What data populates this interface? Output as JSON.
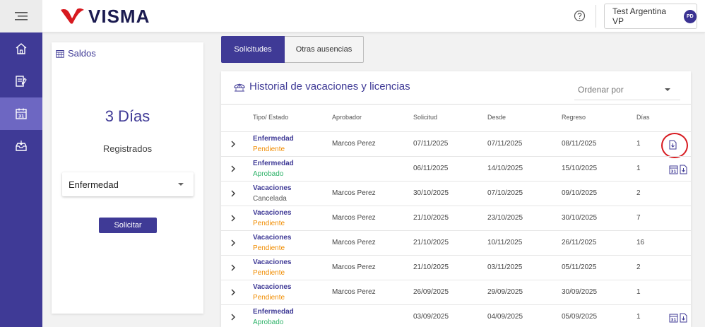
{
  "header": {
    "brand": "VISMA",
    "user_name": "Test Argentina VP",
    "user_initials": "PD"
  },
  "sidebar": {
    "items": [
      {
        "icon": "home-icon"
      },
      {
        "icon": "document-edit-icon"
      },
      {
        "icon": "calendar-icon",
        "active": true
      },
      {
        "icon": "inbox-icon"
      }
    ]
  },
  "saldos": {
    "title": "Saldos",
    "days": "3 Días",
    "status": "Registrados",
    "selected_type": "Enfermedad",
    "request_button": "Solicitar"
  },
  "tabs": [
    {
      "label": "Solicitudes",
      "active": true
    },
    {
      "label": "Otras ausencias",
      "active": false
    }
  ],
  "history": {
    "title": "Historial de vacaciones y licencias",
    "sort_placeholder": "Ordenar por",
    "columns": [
      "Tipo/ Estado",
      "Aprobador",
      "Solicitud",
      "Desde",
      "Regreso",
      "Días"
    ],
    "rows": [
      {
        "tipo": "Enfermedad",
        "estado": "Pendiente",
        "aprobador": "Marcos Perez",
        "solicitud": "07/11/2025",
        "desde": "07/11/2025",
        "regreso": "08/11/2025",
        "dias": "1",
        "icons": "download"
      },
      {
        "tipo": "Enfermedad",
        "estado": "Aprobado",
        "aprobador": "",
        "solicitud": "06/11/2025",
        "desde": "14/10/2025",
        "regreso": "15/10/2025",
        "dias": "1",
        "icons": "calendar-download"
      },
      {
        "tipo": "Vacaciones",
        "estado": "Cancelada",
        "aprobador": "Marcos Perez",
        "solicitud": "30/10/2025",
        "desde": "07/10/2025",
        "regreso": "09/10/2025",
        "dias": "2",
        "icons": ""
      },
      {
        "tipo": "Vacaciones",
        "estado": "Pendiente",
        "aprobador": "Marcos Perez",
        "solicitud": "21/10/2025",
        "desde": "23/10/2025",
        "regreso": "30/10/2025",
        "dias": "7",
        "icons": ""
      },
      {
        "tipo": "Vacaciones",
        "estado": "Pendiente",
        "aprobador": "Marcos Perez",
        "solicitud": "21/10/2025",
        "desde": "10/11/2025",
        "regreso": "26/11/2025",
        "dias": "16",
        "icons": ""
      },
      {
        "tipo": "Vacaciones",
        "estado": "Pendiente",
        "aprobador": "Marcos Perez",
        "solicitud": "21/10/2025",
        "desde": "03/11/2025",
        "regreso": "05/11/2025",
        "dias": "2",
        "icons": ""
      },
      {
        "tipo": "Vacaciones",
        "estado": "Pendiente",
        "aprobador": "Marcos Perez",
        "solicitud": "26/09/2025",
        "desde": "29/09/2025",
        "regreso": "30/09/2025",
        "dias": "1",
        "icons": ""
      },
      {
        "tipo": "Enfermedad",
        "estado": "Aprobado",
        "aprobador": "",
        "solicitud": "03/09/2025",
        "desde": "04/09/2025",
        "regreso": "05/09/2025",
        "dias": "1",
        "icons": "calendar-download"
      }
    ]
  },
  "colors": {
    "brand": "#3f3a96",
    "sidebar_active": "#6d67c2",
    "pending": "#f08c00",
    "approved": "#2fb36a",
    "logo_red": "#d7191f"
  }
}
